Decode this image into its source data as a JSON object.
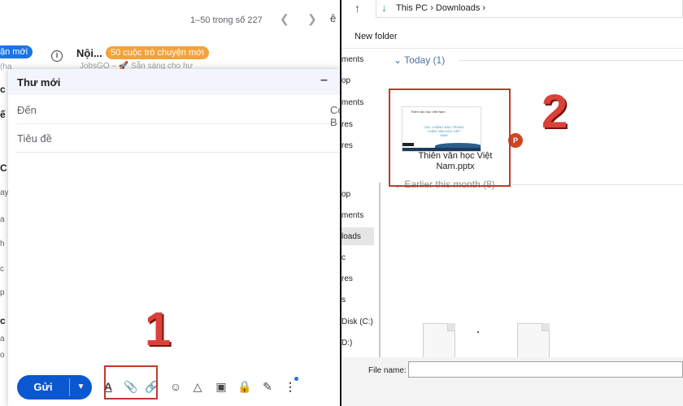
{
  "gmail": {
    "pager": "1–50 trong số 227",
    "lang_fragment": "ê",
    "list": {
      "new_badge": "ận mới",
      "sub_fragment": "(ha",
      "title": "Nội...",
      "badge": "50 cuộc trò chuyện mới",
      "subtitle": "JobsGO – 🚀 Sẵn sàng cho hư"
    },
    "edge_fragments": [
      "c",
      "ế",
      "C",
      "ay",
      "a",
      "h",
      "c",
      "p",
      "c",
      "a",
      "o",
      "C",
      "c"
    ],
    "compose": {
      "title": "Thư mới",
      "minimize": "–",
      "to_label": "Đến",
      "cc_label": "Cc B",
      "subject_label": "Tiêu đề"
    },
    "toolbar": {
      "send_label": "Gửi",
      "send_more": "▼"
    }
  },
  "annotations": {
    "num1": "1",
    "num2": "2"
  },
  "explorer": {
    "crumbs": [
      "This PC",
      "›",
      "Downloads",
      "›"
    ],
    "new_folder": "New folder",
    "nav_items": [
      "ments",
      "op",
      "ments",
      "res",
      "res",
      "op",
      "ments",
      "loads",
      "c",
      "res",
      "s",
      "Disk (C:)",
      "D:)"
    ],
    "group_today": "Today (1)",
    "group_earlier": "Earlier this month (8)",
    "file": {
      "name": "Thiên văn học Việt Nam.pptx",
      "thumb_title": "Thiên văn học Việt Nam",
      "thumb_text": "CÁC CHẶNG ĐÁO TRONG THIÊN VĂN HỌC VIỆT NAM",
      "type_badge": "P"
    },
    "file_name_label": "File name:",
    "file_name_value": ""
  }
}
